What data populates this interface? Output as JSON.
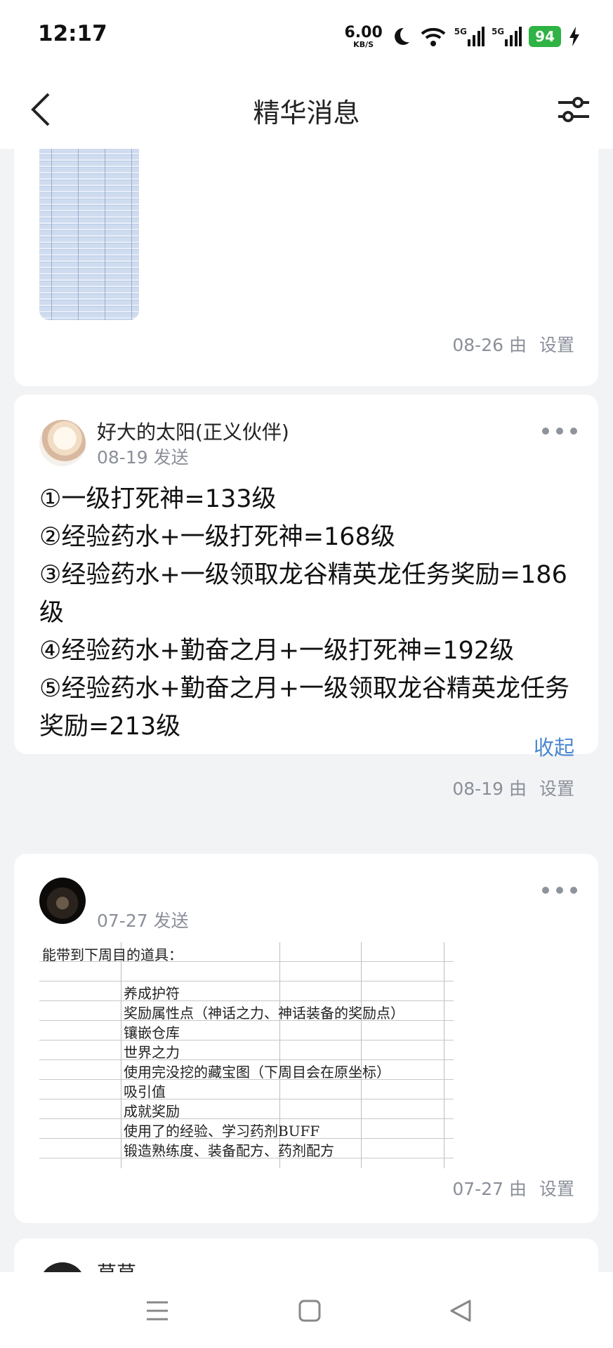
{
  "status_bar": {
    "time": "12:17",
    "net_speed_value": "6.00",
    "net_speed_unit": "KB/S",
    "sim1": "5G",
    "sim2": "5G",
    "battery": "94"
  },
  "nav": {
    "title": "精华消息"
  },
  "posts": [
    {
      "meta_date": "08-26",
      "meta_by": "由",
      "settings_label": "设置"
    },
    {
      "author": "好大的太阳(正义伙伴)",
      "date": "08-19 发送",
      "lines": [
        "①一级打死神=133级",
        "②经验药水+一级打死神=168级",
        "③经验药水+一级领取龙谷精英龙任务奖励=186级",
        "④经验药水+勤奋之月+一级打死神=192级",
        "⑤经验药水+勤奋之月+一级领取龙谷精英龙任务奖励=213级"
      ],
      "collapse_label": "收起",
      "meta_date": "08-19",
      "meta_by": "由",
      "settings_label": "设置"
    },
    {
      "author": "",
      "date": "07-27 发送",
      "sheet": {
        "heading": "能带到下周目的道具：",
        "items": [
          "养成护符",
          "奖励属性点（神话之力、神话装备的奖励点）",
          "镶嵌仓库",
          "世界之力",
          "使用完没挖的藏宝图（下周目会在原坐标）",
          "吸引值",
          "成就奖励",
          "使用了的经验、学习药剂BUFF",
          "锻造熟练度、装备配方、药剂配方"
        ]
      },
      "meta_date": "07-27",
      "meta_by": "由",
      "settings_label": "设置"
    },
    {
      "author": "草草"
    }
  ],
  "colors": {
    "accent": "#4a87d1",
    "battery": "#2fb344",
    "background": "#f2f3f5"
  },
  "icons": [
    "back-icon",
    "filter-icon",
    "more-icon",
    "menu-icon",
    "home-icon",
    "nav-back-icon"
  ]
}
